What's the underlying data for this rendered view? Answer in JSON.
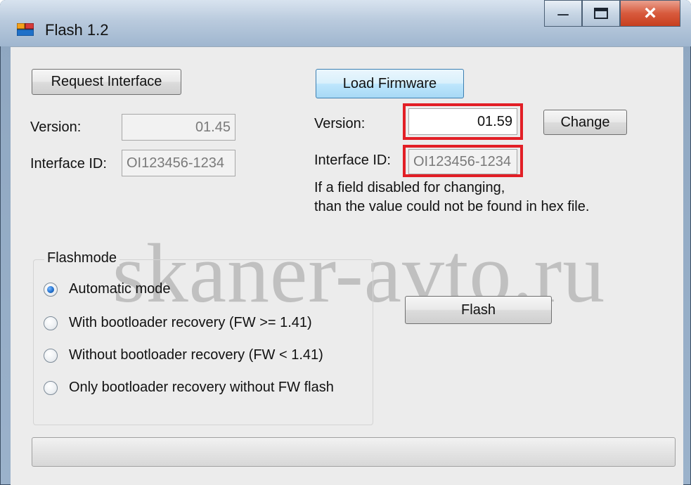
{
  "window": {
    "title": "Flash 1.2",
    "icon": "app-window-icon",
    "controls": {
      "minimize": "minimize-icon",
      "maximize": "maximize-icon",
      "close": "close-icon"
    }
  },
  "left": {
    "request_button": "Request Interface",
    "version_label": "Version:",
    "version_value": "01.45",
    "interface_label": "Interface ID:",
    "interface_value": "OI123456-1234"
  },
  "right": {
    "load_button": "Load Firmware",
    "version_label": "Version:",
    "version_value": "01.59",
    "change_button": "Change",
    "interface_label": "Interface ID:",
    "interface_value": "OI123456-1234",
    "note_line1": "If a field disabled for changing,",
    "note_line2": "than the value could not be found in hex file."
  },
  "watermark": "skaner-avto.ru",
  "flashmode": {
    "title": "Flashmode",
    "selected_index": 0,
    "options": [
      "Automatic mode",
      "With bootloader recovery (FW >= 1.41)",
      "Without bootloader recovery (FW < 1.41)",
      "Only bootloader recovery without FW flash"
    ]
  },
  "flash_button": "Flash",
  "progress": {
    "value": 0
  },
  "colors": {
    "highlight": "#e21f26",
    "window_bg": "#ececec",
    "close_button": "#c7401f"
  }
}
